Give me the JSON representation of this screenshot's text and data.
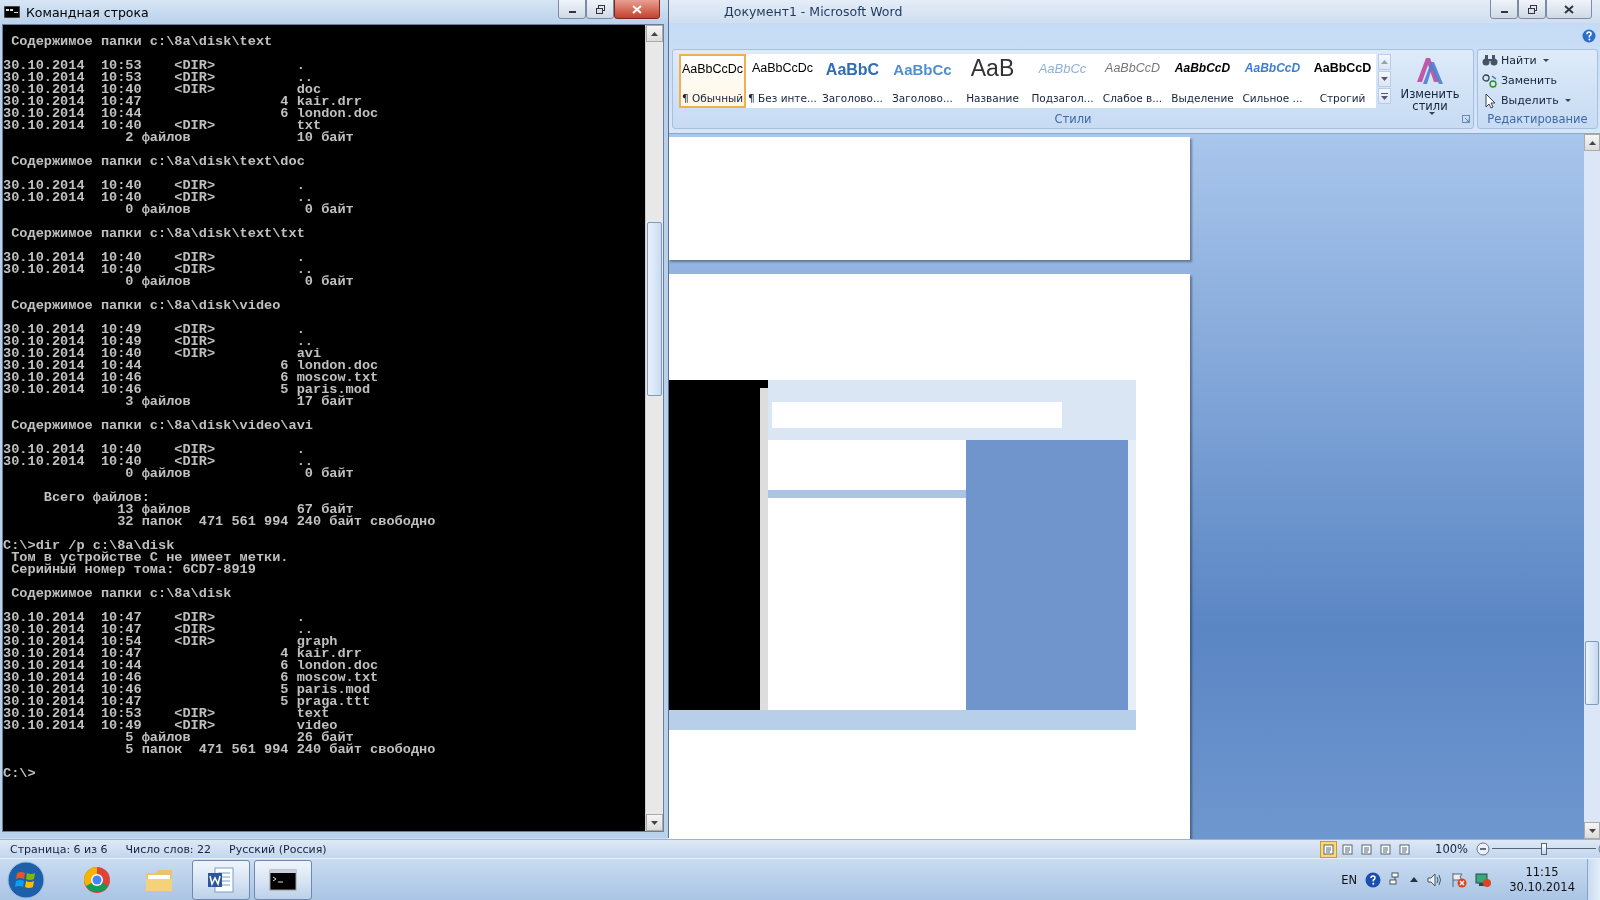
{
  "console": {
    "title": "Командная строка",
    "blocks": [
      [
        " Содержимое папки c:\\8a\\disk\\text"
      ],
      [
        "30.10.2014  10:53    <DIR>          .",
        "30.10.2014  10:53    <DIR>          ..",
        "30.10.2014  10:40    <DIR>          doc",
        "30.10.2014  10:47                 4 kair.drr",
        "30.10.2014  10:44                 6 london.doc",
        "30.10.2014  10:40    <DIR>          txt",
        "               2 файлов             10 байт"
      ],
      [
        " Содержимое папки c:\\8a\\disk\\text\\doc"
      ],
      [
        "30.10.2014  10:40    <DIR>          .",
        "30.10.2014  10:40    <DIR>          ..",
        "               0 файлов              0 байт"
      ],
      [
        " Содержимое папки c:\\8a\\disk\\text\\txt"
      ],
      [
        "30.10.2014  10:40    <DIR>          .",
        "30.10.2014  10:40    <DIR>          ..",
        "               0 файлов              0 байт"
      ],
      [
        " Содержимое папки c:\\8a\\disk\\video"
      ],
      [
        "30.10.2014  10:49    <DIR>          .",
        "30.10.2014  10:49    <DIR>          ..",
        "30.10.2014  10:40    <DIR>          avi",
        "30.10.2014  10:44                 6 london.doc",
        "30.10.2014  10:46                 6 moscow.txt",
        "30.10.2014  10:46                 5 paris.mod",
        "               3 файлов             17 байт"
      ],
      [
        " Содержимое папки c:\\8a\\disk\\video\\avi"
      ],
      [
        "30.10.2014  10:40    <DIR>          .",
        "30.10.2014  10:40    <DIR>          ..",
        "               0 файлов              0 байт"
      ],
      [
        "     Всего файлов:",
        "              13 файлов             67 байт",
        "              32 папок  471 561 994 240 байт свободно"
      ],
      [
        "C:\\>dir /p c:\\8a\\disk",
        " Том в устройстве C не имеет метки.",
        " Серийный номер тома: 6CD7-8919"
      ],
      [
        " Содержимое папки c:\\8a\\disk"
      ],
      [
        "30.10.2014  10:47    <DIR>          .",
        "30.10.2014  10:47    <DIR>          ..",
        "30.10.2014  10:54    <DIR>          graph",
        "30.10.2014  10:47                 4 kair.drr",
        "30.10.2014  10:44                 6 london.doc",
        "30.10.2014  10:46                 6 moscow.txt",
        "30.10.2014  10:46                 5 paris.mod",
        "30.10.2014  10:47                 5 praga.ttt",
        "30.10.2014  10:53    <DIR>          text",
        "30.10.2014  10:49    <DIR>          video",
        "               5 файлов             26 байт",
        "               5 папок  471 561 994 240 байт свободно"
      ],
      [
        "C:\\>"
      ]
    ]
  },
  "word": {
    "title": "Документ1 - Microsoft Word",
    "styles": [
      {
        "sample": "AaBbCcDc",
        "label": "¶ Обычный",
        "kind": "normal",
        "selected": true
      },
      {
        "sample": "AaBbCcDc",
        "label": "¶ Без инте...",
        "kind": "normal",
        "selected": false
      },
      {
        "sample": "AaBbC",
        "label": "Заголово...",
        "kind": "heading",
        "selected": false
      },
      {
        "sample": "AaBbCc",
        "label": "Заголово...",
        "kind": "heading2",
        "selected": false
      },
      {
        "sample": "AaB",
        "label": "Название",
        "kind": "title",
        "selected": false
      },
      {
        "sample": "AaBbCc",
        "label": "Подзагол...",
        "kind": "subtitle",
        "selected": false
      },
      {
        "sample": "AaBbCcD",
        "label": "Слабое в...",
        "kind": "subtle",
        "selected": false
      },
      {
        "sample": "AaBbCcD",
        "label": "Выделение",
        "kind": "emphasis",
        "selected": false
      },
      {
        "sample": "AaBbCcD",
        "label": "Сильное ...",
        "kind": "intense",
        "selected": false
      },
      {
        "sample": "AaBbCcD",
        "label": "Строгий",
        "kind": "strong",
        "selected": false
      }
    ],
    "change_styles": "Изменить стили",
    "styles_group": "Стили",
    "editing": [
      {
        "label": "Найти",
        "kind": "find",
        "menu": true
      },
      {
        "label": "Заменить",
        "kind": "replace",
        "menu": false
      },
      {
        "label": "Выделить",
        "kind": "select",
        "menu": true
      }
    ],
    "editing_group": "Редактирование",
    "status_bar": {
      "items": [
        "Страница: 6 из 6",
        "Число слов: 22",
        "Русский (Россия)"
      ],
      "view_buttons": [
        {
          "selected": true
        },
        {
          "selected": false
        },
        {
          "selected": false
        },
        {
          "selected": false
        },
        {
          "selected": false
        }
      ],
      "zoom": "100%",
      "zoom_slider": {
        "level": 0.5
      }
    }
  },
  "taskbar": {
    "apps": [
      {
        "kind": "browser",
        "running": false
      },
      {
        "kind": "folder",
        "running": false
      },
      {
        "kind": "word",
        "running": true
      },
      {
        "kind": "console",
        "running": true
      }
    ],
    "language": "EN",
    "time": "11:15",
    "date": "30.10.2014"
  }
}
